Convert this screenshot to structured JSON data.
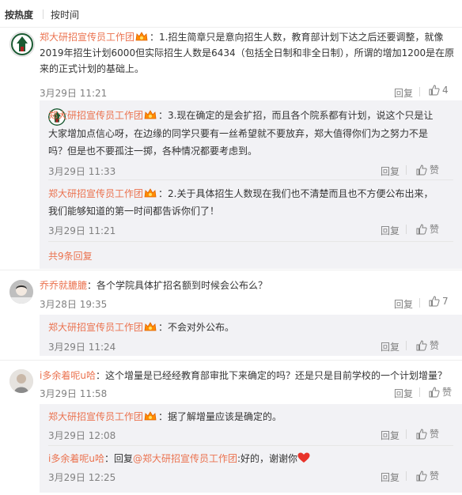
{
  "tabs": {
    "hot": "按热度",
    "time": "按时间"
  },
  "user_main": "郑大研招宣传员工作团",
  "comments": [
    {
      "lines": [
        "：1.招生简章只是意向招生人数，教育部计划下达之后还要调整，就像",
        "2019年招生计划6000但实际招生人数是6434（包括全日制和非全日制），所谓的增加1200是在原",
        "来的正式计划的基础上。"
      ],
      "time": "3月29日 11:21",
      "reply": "回复",
      "likes": "4"
    }
  ],
  "sub1": [
    {
      "lines": [
        "：3.现在确定的是会扩招，而且各个院系都有计划，说这个只是让",
        "大家增加点信心呀，在边缘的同学只要有一丝希望就不要放弃，郑大值得你们为之努力不是",
        "吗？但是也不要孤注一掷，各种情况都要考虑到。"
      ],
      "time": "3月29日 11:33",
      "reply": "回复",
      "likes": "赞"
    },
    {
      "lines": [
        "：2.关于具体招生人数现在我们也不清楚而且也不方便公布出来，",
        "我们能够知道的第一时间都告诉你们了！"
      ],
      "time": "3月29日 11:21",
      "reply": "回复",
      "likes": "赞"
    }
  ],
  "more_replies": "共9条回复",
  "c2": {
    "user": "乔乔就膔膔",
    "text": "：各个学院具体扩招名额到时候会公布么？",
    "time": "3月28日 19:35",
    "reply": "回复",
    "likes": "7"
  },
  "c2_sub": {
    "text": "：不会对外公布。",
    "time": "3月29日 11:24",
    "reply": "回复",
    "likes": "赞"
  },
  "c3": {
    "user": "i多余着呢u哈",
    "text": "：这个增量是已经经教育部审批下来确定的吗？还是只是目前学校的一个计划增量？",
    "time": "3月29日 11:58",
    "reply": "回复",
    "likes": "赞"
  },
  "c3_sub1": {
    "text": "：据了解增量应该是确定的。",
    "time": "3月29日 12:08",
    "reply": "回复",
    "likes": "赞"
  },
  "c3_sub2": {
    "user": "i多余着呢u哈",
    "prefix": "：回复",
    "mention": "@郑大研招宣传员工作团",
    "text": ":好的，谢谢你",
    "time": "3月29日 12:25",
    "reply": "回复",
    "likes": "赞"
  },
  "colors": {
    "name": "#eb7350",
    "text": "#333333",
    "meta": "#808080",
    "subbg": "#f2f2f5"
  }
}
